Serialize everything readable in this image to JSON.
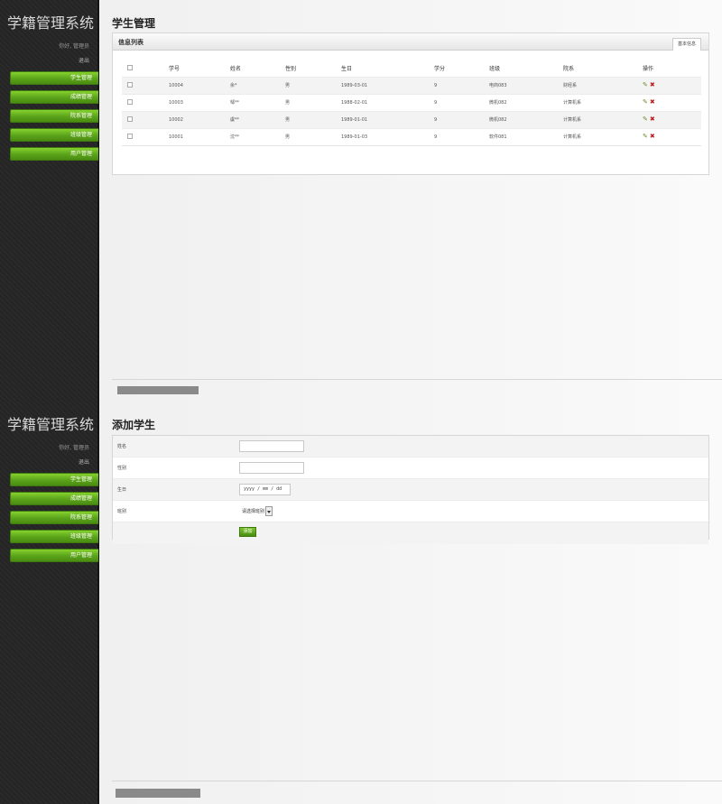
{
  "app": {
    "title": "学籍管理系统",
    "greeting": "你好, 管理员",
    "logout": "退出"
  },
  "nav": [
    "学生管理",
    "成绩管理",
    "院系管理",
    "班级管理",
    "用户管理"
  ],
  "list_page": {
    "title": "学生管理",
    "box_title": "信息列表",
    "tab_label": "基本信息",
    "columns": [
      "学号",
      "姓名",
      "性别",
      "生日",
      "学分",
      "班级",
      "院系",
      "操作"
    ],
    "rows": [
      [
        "10004",
        "余*",
        "男",
        "1989-03-01",
        "9",
        "电商083",
        "财经系"
      ],
      [
        "10003",
        "邹**",
        "男",
        "1988-02-01",
        "9",
        "微机082",
        "计算机系"
      ],
      [
        "10002",
        "虞**",
        "男",
        "1989-01-01",
        "9",
        "微机082",
        "计算机系"
      ],
      [
        "10001",
        "沈**",
        "男",
        "1989-01-03",
        "9",
        "软件081",
        "计算机系"
      ]
    ],
    "action_icons": [
      "pencil-icon",
      "x-icon"
    ],
    "accent_color": "#5aa31a"
  },
  "add_page": {
    "title": "添加学生",
    "fields": {
      "name_label": "姓名",
      "sex_label": "性别",
      "birthday_label": "生日",
      "birthday_placeholder": "yyyy / mm / dd",
      "class_label": "班别",
      "class_select_value": "请选择班别"
    },
    "submit_label": "添加"
  }
}
